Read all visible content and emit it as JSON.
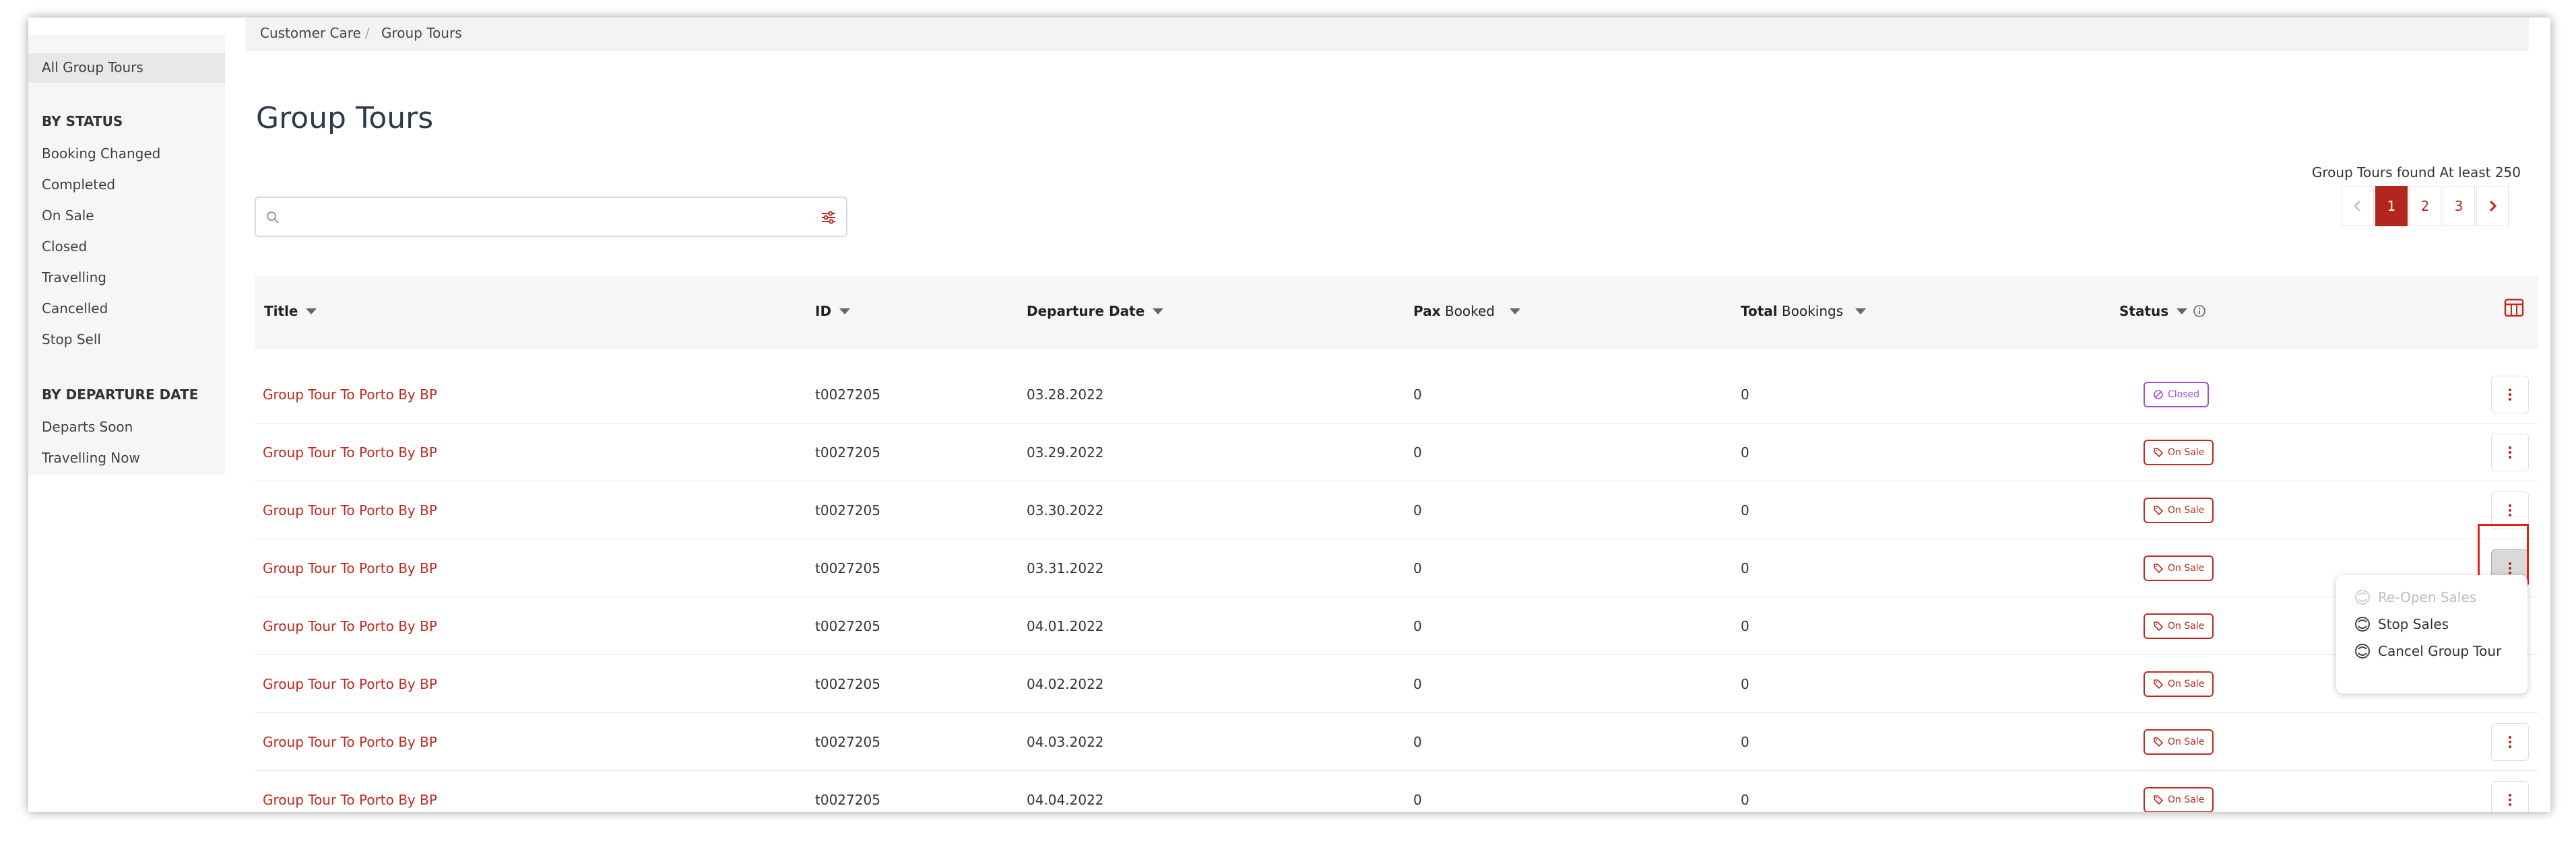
{
  "sidebar": {
    "all_label": "All Group Tours",
    "status_heading": "BY STATUS",
    "status_items": [
      "Booking Changed",
      "Completed",
      "On Sale",
      "Closed",
      "Travelling",
      "Cancelled",
      "Stop Sell"
    ],
    "date_heading": "BY DEPARTURE DATE",
    "date_items": [
      "Departs Soon",
      "Travelling Now"
    ]
  },
  "breadcrumb": {
    "first": "Customer Care",
    "separator": "/",
    "second": "Group Tours"
  },
  "page_title": "Group Tours",
  "search": {
    "placeholder": ""
  },
  "results_text": "Group Tours found At least 250",
  "pagination": {
    "pages": [
      "1",
      "2",
      "3"
    ],
    "current": "1"
  },
  "table": {
    "columns": {
      "title": "Title",
      "id": "ID",
      "departure": "Departure Date",
      "pax_bold": "Pax",
      "pax_rest": " Booked",
      "total_bold": "Total",
      "total_rest": " Bookings",
      "status": "Status"
    },
    "rows": [
      {
        "title": "Group Tour To Porto By BP",
        "id": "t0027205",
        "departure": "03.28.2022",
        "pax": "0",
        "total": "0",
        "status": "Closed"
      },
      {
        "title": "Group Tour To Porto By BP",
        "id": "t0027205",
        "departure": "03.29.2022",
        "pax": "0",
        "total": "0",
        "status": "On Sale"
      },
      {
        "title": "Group Tour To Porto By BP",
        "id": "t0027205",
        "departure": "03.30.2022",
        "pax": "0",
        "total": "0",
        "status": "On Sale"
      },
      {
        "title": "Group Tour To Porto By BP",
        "id": "t0027205",
        "departure": "03.31.2022",
        "pax": "0",
        "total": "0",
        "status": "On Sale"
      },
      {
        "title": "Group Tour To Porto By BP",
        "id": "t0027205",
        "departure": "04.01.2022",
        "pax": "0",
        "total": "0",
        "status": "On Sale"
      },
      {
        "title": "Group Tour To Porto By BP",
        "id": "t0027205",
        "departure": "04.02.2022",
        "pax": "0",
        "total": "0",
        "status": "On Sale"
      },
      {
        "title": "Group Tour To Porto By BP",
        "id": "t0027205",
        "departure": "04.03.2022",
        "pax": "0",
        "total": "0",
        "status": "On Sale"
      },
      {
        "title": "Group Tour To Porto By BP",
        "id": "t0027205",
        "departure": "04.04.2022",
        "pax": "0",
        "total": "0",
        "status": "On Sale"
      }
    ]
  },
  "row_menu": {
    "items": [
      "Re-Open Sales",
      "Stop Sales",
      "Cancel Group Tour"
    ],
    "disabled": [
      "Re-Open Sales"
    ]
  },
  "colors": {
    "accent": "#b3261e",
    "closed": "#a64ad8",
    "highlight": "#e0201a"
  }
}
